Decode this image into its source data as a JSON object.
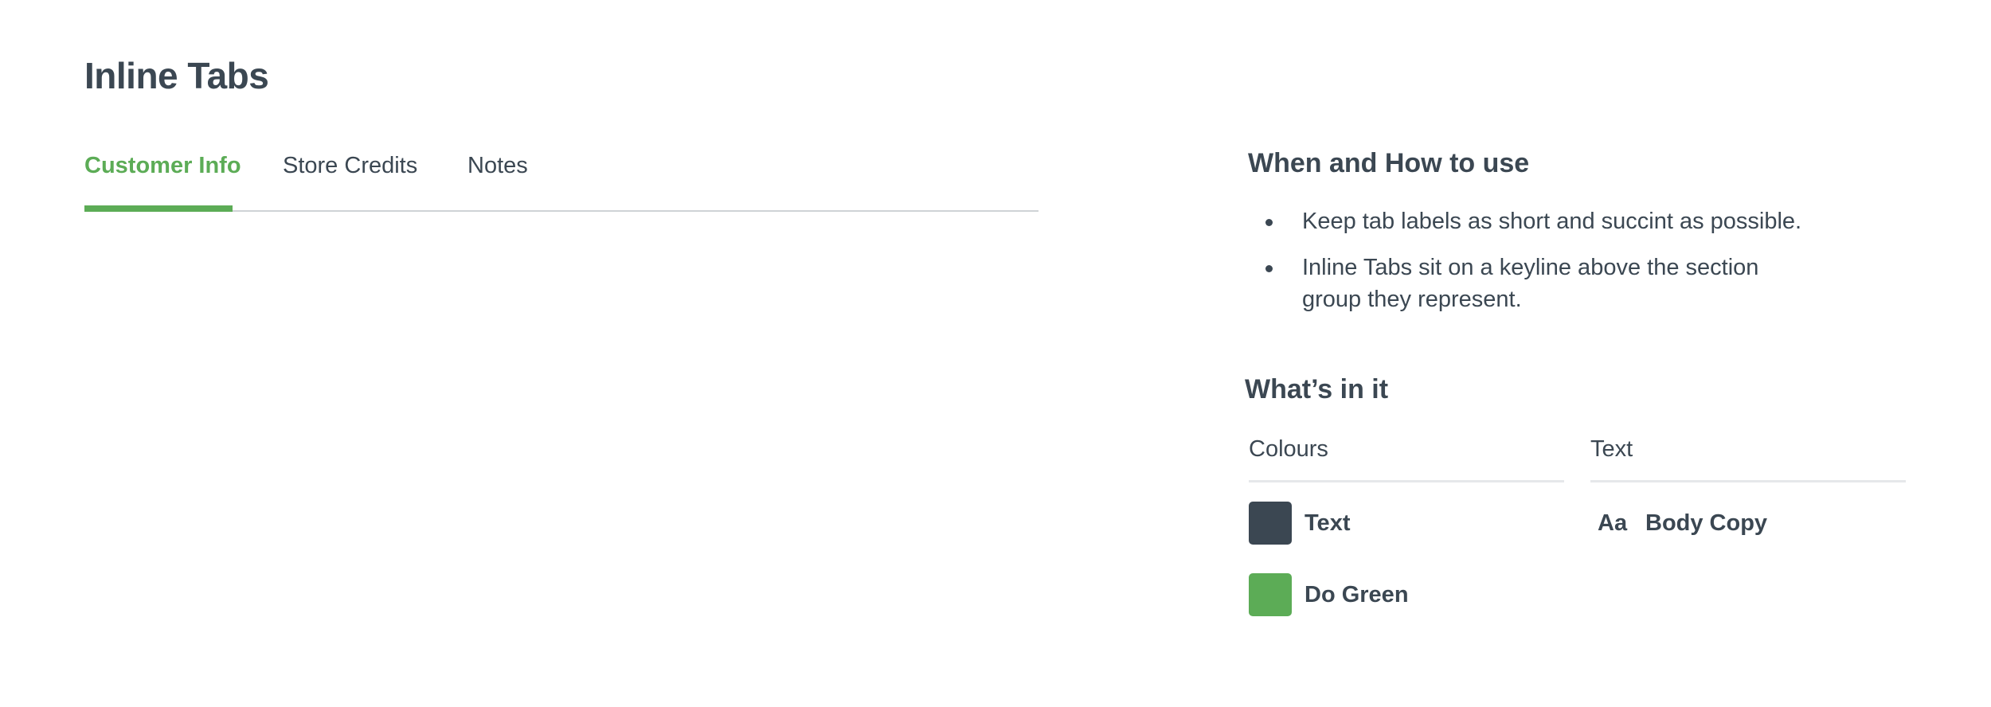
{
  "page": {
    "title": "Inline Tabs"
  },
  "tabs": {
    "items": [
      {
        "label": "Customer Info",
        "active": true
      },
      {
        "label": "Store Credits",
        "active": false
      },
      {
        "label": "Notes",
        "active": false
      }
    ]
  },
  "usage": {
    "heading": "When and How to use",
    "items": [
      "Keep tab labels as short and succint as possible.",
      "Inline Tabs sit on a keyline above the section group they represent."
    ]
  },
  "contents": {
    "heading": "What’s in it",
    "colours": {
      "label": "Colours",
      "items": [
        {
          "name": "Text",
          "color": "#3b4752"
        },
        {
          "name": "Do Green",
          "color": "#5cac56"
        }
      ]
    },
    "text": {
      "label": "Text",
      "items": [
        {
          "sample": "Aa",
          "name": "Body Copy"
        }
      ]
    }
  },
  "colors": {
    "accent": "#5cac56",
    "text": "#3b4752",
    "keyline": "#cfd3d6"
  }
}
